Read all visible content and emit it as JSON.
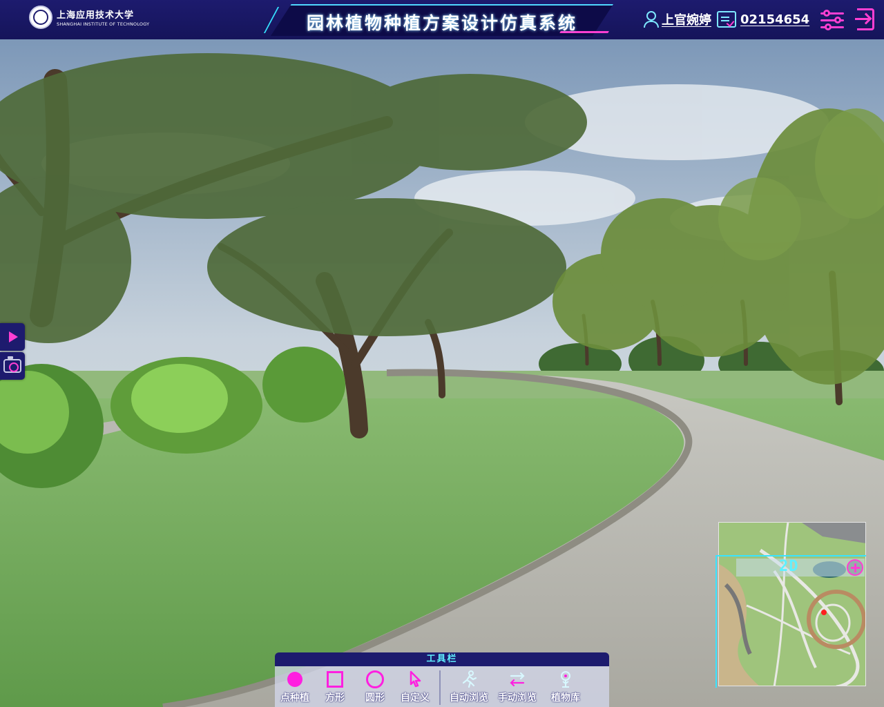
{
  "header": {
    "logo_cn": "上海应用技术大学",
    "logo_en": "SHANGHAI INSTITUTE OF TECHNOLOGY",
    "title": "园林植物种植方案设计仿真系统",
    "user_name": "上官婉婷",
    "user_id": "02154654"
  },
  "minimap": {
    "mode_label": "2D",
    "zoom_in_icon": "zoom-in-icon"
  },
  "toolbar": {
    "title": "工具栏",
    "tools": [
      {
        "label": "点种植",
        "icon": "dot-plant-icon"
      },
      {
        "label": "方形",
        "icon": "square-icon"
      },
      {
        "label": "圆形",
        "icon": "circle-icon"
      },
      {
        "label": "自定义",
        "icon": "custom-cursor-icon"
      },
      {
        "label": "自动浏览",
        "icon": "running-person-icon"
      },
      {
        "label": "手动浏览",
        "icon": "swap-arrows-icon"
      },
      {
        "label": "植物库",
        "icon": "plant-library-icon"
      }
    ]
  },
  "colors": {
    "header_bg": "#1d1b6e",
    "accent_cyan": "#38e4ff",
    "accent_magenta": "#ff1fe0"
  }
}
